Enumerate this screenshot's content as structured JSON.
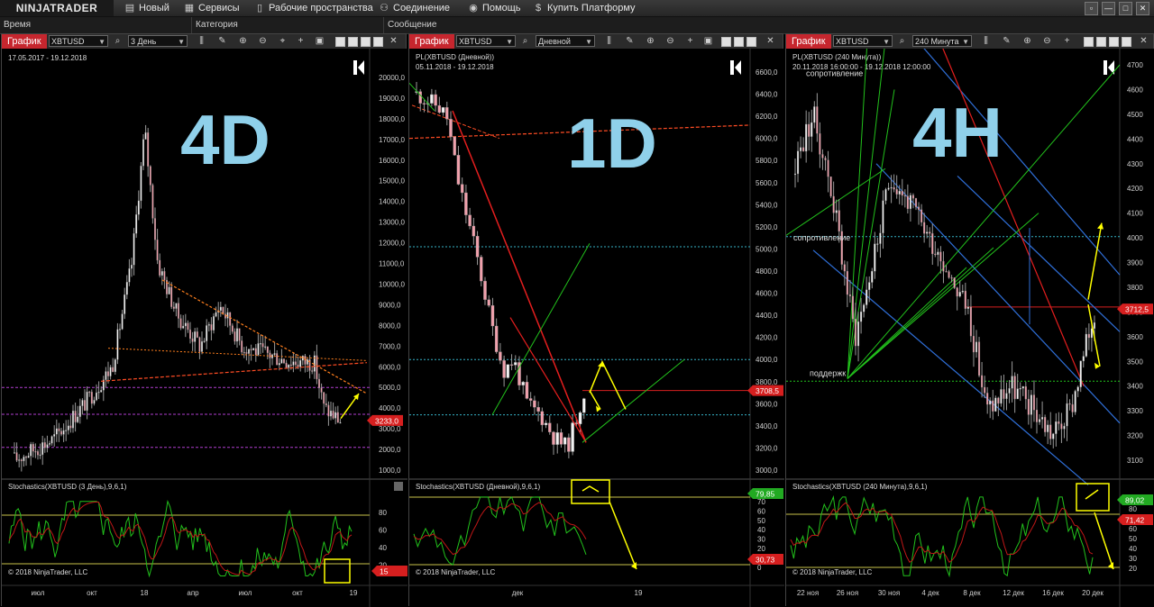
{
  "app": {
    "logo": "NINJATRADER"
  },
  "menu": [
    {
      "icon": "new-icon",
      "glyph": "▤",
      "label": "Новый"
    },
    {
      "icon": "services-icon",
      "glyph": "▦",
      "label": "Сервисы"
    },
    {
      "icon": "workspaces-icon",
      "glyph": "▯",
      "label": "Рабочие пространства"
    },
    {
      "icon": "connection-icon",
      "glyph": "⚇",
      "label": "Соединение"
    },
    {
      "icon": "help-icon",
      "glyph": "◉",
      "label": "Помощь"
    },
    {
      "icon": "buy-platform-icon",
      "glyph": "$",
      "label": "Купить Платформу"
    }
  ],
  "window_controls": [
    "▫",
    "—",
    "□",
    "✕"
  ],
  "header": {
    "time": "Время",
    "category": "Категория",
    "message": "Сообщение"
  },
  "charts": [
    {
      "tab": "График",
      "instrument": "XBTUSD",
      "period": "3 День",
      "date_range": "17.05.2017 - 19.12.2018",
      "big_label": "4D",
      "price_ticks": [
        "20000,0",
        "19000,0",
        "18000,0",
        "17000,0",
        "16000,0",
        "15000,0",
        "14000,0",
        "13000,0",
        "12000,0",
        "11000,0",
        "10000,0",
        "9000,0",
        "8000,0",
        "7000,0",
        "6000,0",
        "5000,0",
        "4000,0",
        "3000,0",
        "2000,0",
        "1000,0"
      ],
      "price_badge": "3233,0",
      "osc_label": "Stochastics(XBTUSD (3 День),9,6,1)",
      "osc_ticks": [
        "80",
        "60",
        "40",
        "20"
      ],
      "osc_badge": "15",
      "copyright": "© 2018 NinjaTrader, LLC",
      "time_ticks": [
        "июл",
        "окт",
        "18",
        "апр",
        "июл",
        "окт",
        "19"
      ],
      "colors": {
        "support": "#b03ed0",
        "trend": "#ff7f1e"
      }
    },
    {
      "tab": "График",
      "instrument": "XBTUSD",
      "period": "Дневной",
      "indicator_label": "PL(XBTUSD (Дневной))",
      "date_range": "05.11.2018 - 19.12.2018",
      "big_label": "1D",
      "price_ticks": [
        "6600,0",
        "6400,0",
        "6200,0",
        "6000,0",
        "5800,0",
        "5600,0",
        "5400,0",
        "5200,0",
        "5000,0",
        "4800,0",
        "4600,0",
        "4400,0",
        "4200,0",
        "4000,0",
        "3800,0",
        "3600,0",
        "3400,0",
        "3200,0",
        "3000,0"
      ],
      "price_badge": "3708,5",
      "osc_label": "Stochastics(XBTUSD (Дневной),9,6,1)",
      "osc_ticks": [
        "70",
        "60",
        "50",
        "40",
        "30",
        "20",
        "10",
        "0"
      ],
      "osc_badge_top": "79,85",
      "osc_badge": "30,73",
      "copyright": "© 2018 NinjaTrader, LLC",
      "time_ticks": [
        "дек",
        "19"
      ]
    },
    {
      "tab": "График",
      "instrument": "XBTUSD",
      "period": "240 Минута",
      "indicator_label": "PL(XBTUSD (240 Минута))",
      "date_range": "20.11.2018 16:00:00 - 19.12.2018 12:00:00",
      "big_label": "4H",
      "annotations": [
        "сопротивление",
        "сопротивлениe",
        "поддержк"
      ],
      "price_ticks": [
        "4700",
        "4600",
        "4500",
        "4400",
        "4300",
        "4200",
        "4100",
        "4000",
        "3900",
        "3800",
        "3700",
        "3600",
        "3500",
        "3400",
        "3300",
        "3200",
        "3100"
      ],
      "price_badge": "3712,5",
      "osc_label": "Stochastics(XBTUSD (240 Минута),9,6,1)",
      "osc_ticks": [
        "80",
        "70",
        "60",
        "50",
        "40",
        "30",
        "20"
      ],
      "osc_badge_top": "89,02",
      "osc_badge": "71,42",
      "copyright": "© 2018 NinjaTrader, LLC",
      "time_ticks": [
        "22 ноя",
        "26 ноя",
        "30 ноя",
        "4 дек",
        "8 дек",
        "12 дек",
        "16 дек",
        "20 дек"
      ]
    }
  ]
}
